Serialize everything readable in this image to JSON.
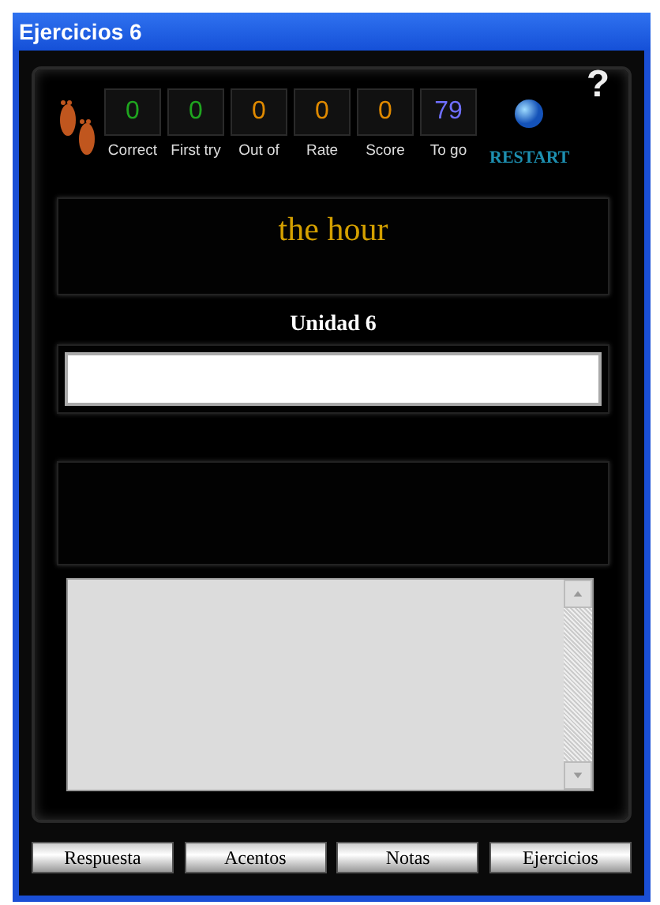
{
  "window": {
    "title": "Ejercicios 6"
  },
  "help": "?",
  "stats": [
    {
      "value": "0",
      "label": "Correct",
      "color": "#1fa51f"
    },
    {
      "value": "0",
      "label": "First try",
      "color": "#1fa51f"
    },
    {
      "value": "0",
      "label": "Out of",
      "color": "#e08a00"
    },
    {
      "value": "0",
      "label": "Rate",
      "color": "#e08a00"
    },
    {
      "value": "0",
      "label": "Score",
      "color": "#e08a00"
    },
    {
      "value": "79",
      "label": "To go",
      "color": "#6f6fff"
    }
  ],
  "restart": "RESTART",
  "prompt": "the hour",
  "unit": "Unidad 6",
  "buttons": [
    "Respuesta",
    "Acentos",
    "Notas",
    "Ejercicios"
  ]
}
